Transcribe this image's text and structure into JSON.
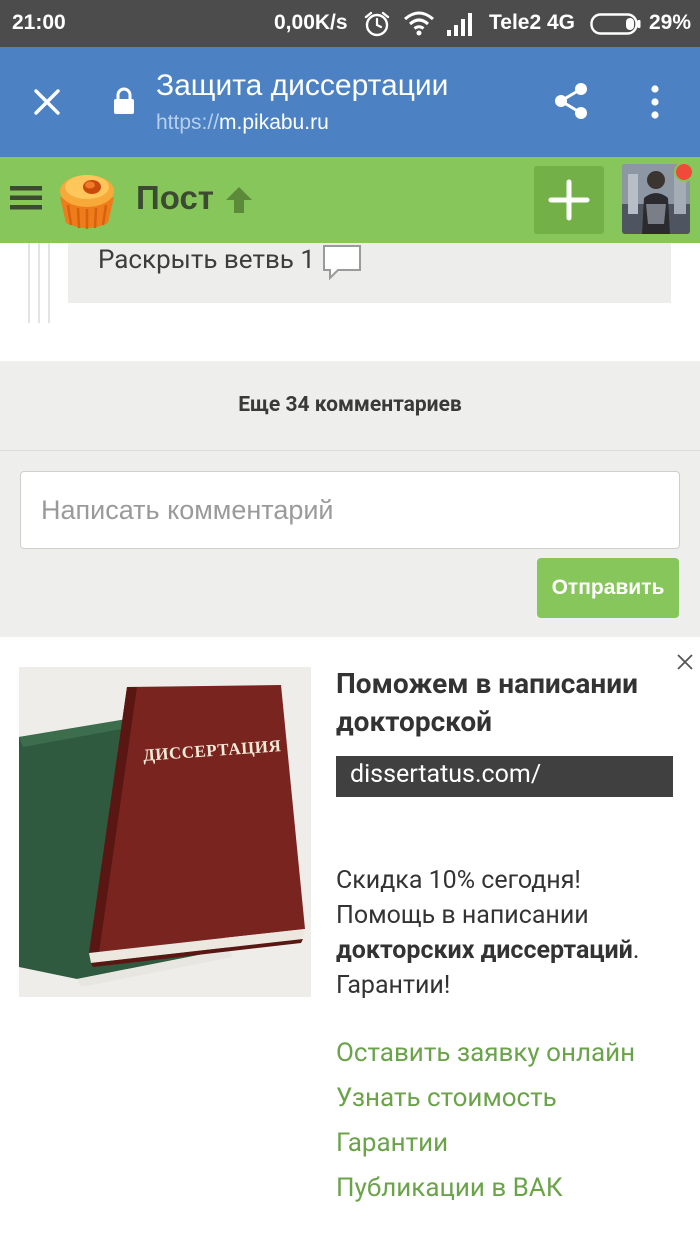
{
  "status_bar": {
    "time": "21:00",
    "net_speed": "0,00K/s",
    "carrier": "Tele2 4G",
    "battery": "29%",
    "icons": [
      "alarm-icon",
      "wifi-icon",
      "signal-icon",
      "battery-icon"
    ]
  },
  "browser": {
    "title": "Защита диссертации",
    "url_scheme": "https://",
    "url_host": "m.pikabu.ru",
    "icons": [
      "close-icon",
      "lock-icon",
      "share-icon",
      "more-vert-icon"
    ]
  },
  "site_header": {
    "section_label": "Пост",
    "icons": [
      "menu-icon",
      "pikabu-logo",
      "arrow-up-icon",
      "plus-icon",
      "avatar"
    ],
    "colors": {
      "header_bg": "#86c65a",
      "add_button_bg": "#74b048",
      "notification": "#ef4a3a"
    }
  },
  "thread": {
    "expand_label": "Раскрыть ветвь 1"
  },
  "comments": {
    "more_label": "Еще 34 комментариев",
    "input_placeholder": "Написать комментарий",
    "send_label": "Отправить"
  },
  "ad": {
    "headline": "Поможем в написании докторской",
    "domain": "dissertatus.com/",
    "image_book_title": "ДИССЕРТАЦИЯ",
    "desc_part1": "Скидка 10% сегодня! Помощь в написании ",
    "desc_bold": "докторских диссертаций",
    "desc_part2": ". Гарантии!",
    "links": [
      "Оставить заявку онлайн",
      "Узнать стоимость",
      "Гарантии",
      "Публикации в ВАК"
    ],
    "colors": {
      "link": "#6ba34b",
      "domain_bg": "#404040"
    }
  }
}
